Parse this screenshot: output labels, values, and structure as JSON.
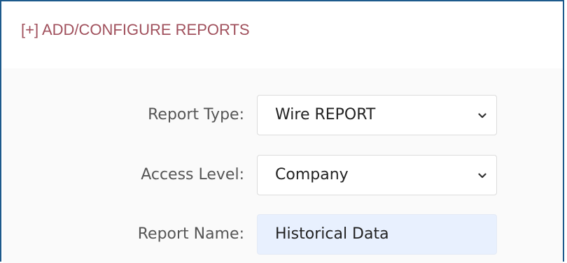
{
  "panel": {
    "header": "[+] ADD/CONFIGURE REPORTS"
  },
  "form": {
    "report_type": {
      "label": "Report Type:",
      "value": "Wire REPORT"
    },
    "access_level": {
      "label": "Access Level:",
      "value": "Company"
    },
    "report_name": {
      "label": "Report Name:",
      "value": "Historical Data"
    }
  },
  "icons": {
    "dropdown": "chevron-down-icon"
  },
  "colors": {
    "header_text": "#a0505c",
    "panel_border": "#1d5a8c",
    "autofill_bg": "#e8f0fe"
  }
}
